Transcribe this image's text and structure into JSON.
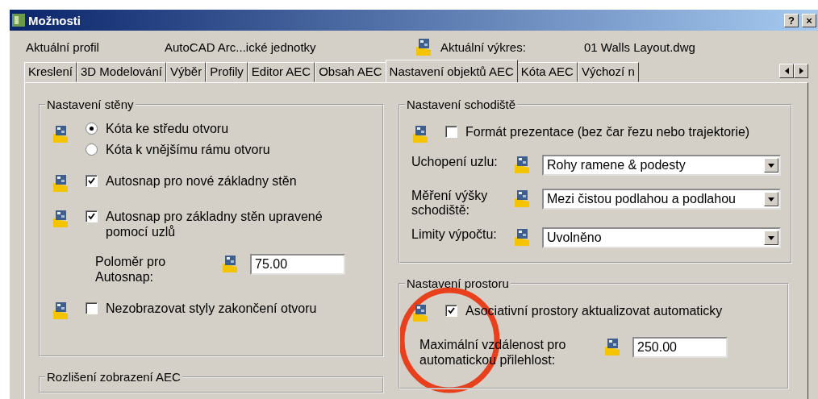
{
  "window": {
    "title": "Možnosti",
    "help": "?",
    "close": "×"
  },
  "profile": {
    "label": "Aktuální profil",
    "value": "AutoCAD Arc...ické jednotky"
  },
  "drawing": {
    "label": "Aktuální výkres:",
    "value": "01 Walls Layout.dwg"
  },
  "tabs": [
    {
      "label": "Kreslení",
      "selected": false
    },
    {
      "label": "3D Modelování",
      "selected": false
    },
    {
      "label": "Výběr",
      "selected": false
    },
    {
      "label": "Profily",
      "selected": false
    },
    {
      "label": "Editor AEC",
      "selected": false
    },
    {
      "label": "Obsah AEC",
      "selected": false
    },
    {
      "label": "Nastavení objektů AEC",
      "selected": true
    },
    {
      "label": "Kóta AEC",
      "selected": false
    },
    {
      "label": "Výchozí n",
      "selected": false
    }
  ],
  "wall_settings": {
    "title": "Nastavení stěny",
    "items": [
      {
        "kind": "radio",
        "options": [
          {
            "label": "Kóta ke středu otvoru",
            "selected": true
          },
          {
            "label": "Kóta k vnějšímu rámu otvoru",
            "selected": false
          }
        ]
      },
      {
        "kind": "checkbox",
        "label": "Autosnap pro nové základny stěn",
        "checked": true
      },
      {
        "kind": "checkbox",
        "label": "Autosnap pro základny stěn upravené pomocí uzlů",
        "checked": true
      },
      {
        "kind": "number",
        "label": "Poloměr pro Autosnap:",
        "value": "75.00"
      },
      {
        "kind": "checkbox",
        "label": "Nezobrazovat styly zakončení otvoru",
        "checked": false
      }
    ]
  },
  "display_resolution": {
    "title": "Rozlišení zobrazení AEC"
  },
  "stair_settings": {
    "title": "Nastavení schodiště",
    "items": [
      {
        "kind": "checkbox",
        "label": "Formát prezentace (bez čar řezu nebo trajektorie)",
        "checked": false
      },
      {
        "kind": "dropdown",
        "label": "Uchopení uzlu:",
        "value": "Rohy ramene & podesty"
      },
      {
        "kind": "dropdown",
        "label": "Měření výšky schodiště:",
        "value": "Mezi čistou podlahou a podlahou"
      },
      {
        "kind": "dropdown",
        "label": "Limity výpočtu:",
        "value": "Uvolněno"
      }
    ]
  },
  "space_settings": {
    "title": "Nastavení prostoru",
    "items": [
      {
        "kind": "checkbox",
        "label": "Asociativní prostory aktualizovat automaticky",
        "checked": true
      },
      {
        "kind": "number",
        "label": "Maximální vzdálenost pro automatickou přilehlost:",
        "value": "250.00"
      }
    ]
  }
}
